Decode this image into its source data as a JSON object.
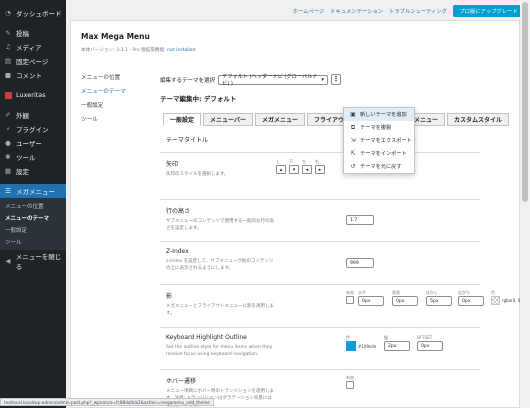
{
  "sidebar": {
    "dashboard": "ダッシュボード",
    "posts": "投稿",
    "media": "メディア",
    "pages": "固定ページ",
    "comments": "コメント",
    "luxeritas": "Luxeritas",
    "appearance": "外観",
    "plugins": "プラグイン",
    "users": "ユーザー",
    "tools": "ツール",
    "settings": "設定",
    "megamenu": "メガメニュー",
    "sub": [
      "メニューの位置",
      "メニューのテーマ",
      "一般設定",
      "ツール"
    ],
    "collapse": "メニューを閉じる"
  },
  "topbar": {
    "links": [
      "ホームページ",
      "ドキュメンテーション",
      "トラブルシューティング"
    ],
    "pro": "プロ版にアップグレード"
  },
  "panel": {
    "title": "Max Mega Menu",
    "version": "本体バージョン: 3.3.1 - Pro 版拡張機能: ",
    "not_installed": "not installed"
  },
  "subnav": [
    "メニューの位置",
    "メニューのテーマ",
    "一般設定",
    "ツール"
  ],
  "edit": {
    "label": "編集するテーマを選択",
    "selected": "デフォルト (ヘッダーナビ (グローバルナビ) )",
    "dots": "⋮",
    "heading": "テーマ編集中: デフォルト"
  },
  "tabs": [
    "一般設定",
    "メニューバー",
    "メガメニュー",
    "フライアウトメニュー",
    "モバイルメニュー",
    "カスタムスタイル"
  ],
  "dropdown": [
    "新しいテーマを追加",
    "テーマを複製",
    "テーマをエクスポート",
    "テーマをインポート",
    "テーマを元に戻す"
  ],
  "rows": {
    "title": {
      "label": "テーマタイトル"
    },
    "arrow": {
      "label": "矢印",
      "desc": "矢印のスタイルを選択します。",
      "sides": [
        "上",
        "下",
        "左",
        "右"
      ],
      "values": [
        "▴",
        "▾",
        "◂",
        "▸"
      ]
    },
    "lineheight": {
      "label": "行の高さ",
      "desc": "サブメニューのコンテンツで使用する一般的な行の高さを設定します。",
      "value": "1.7"
    },
    "zindex": {
      "label": "Z-Index",
      "desc": "z-index を設定して、サブメニューが他のコンテンツの上に表示されるようにします。",
      "value": "999"
    },
    "shadow": {
      "label": "影",
      "desc": "メガメニューとフライアウトメニューに影を適用します。",
      "heads": [
        "有効",
        "水平",
        "垂直",
        "ぼかし",
        "広がり",
        "色"
      ],
      "values": [
        "0px",
        "0px",
        "5px",
        "0px"
      ],
      "color": "rgba(0, 0, 0, 0.1)"
    },
    "outline": {
      "label": "Keyboard Highlight Outline",
      "desc": "Set the outline style for menu items when they receive focus using keyboard navigation.",
      "heads": [
        "色",
        "幅",
        "OFFSET"
      ],
      "color": "#109cde",
      "accent": "#109cde",
      "values": [
        "2px",
        "0px"
      ]
    },
    "hover": {
      "label": "ホバー遷移",
      "desc": "メニュー項目にホバー時のトランジションを適用します。注意: トランジションはグラデーション背景には適用されません。",
      "head": "有効"
    }
  },
  "status": "testlocal.local/wp-admin/admin-post.php?_wpnonce=fc88da0cb2&action=megamenu_add_theme"
}
